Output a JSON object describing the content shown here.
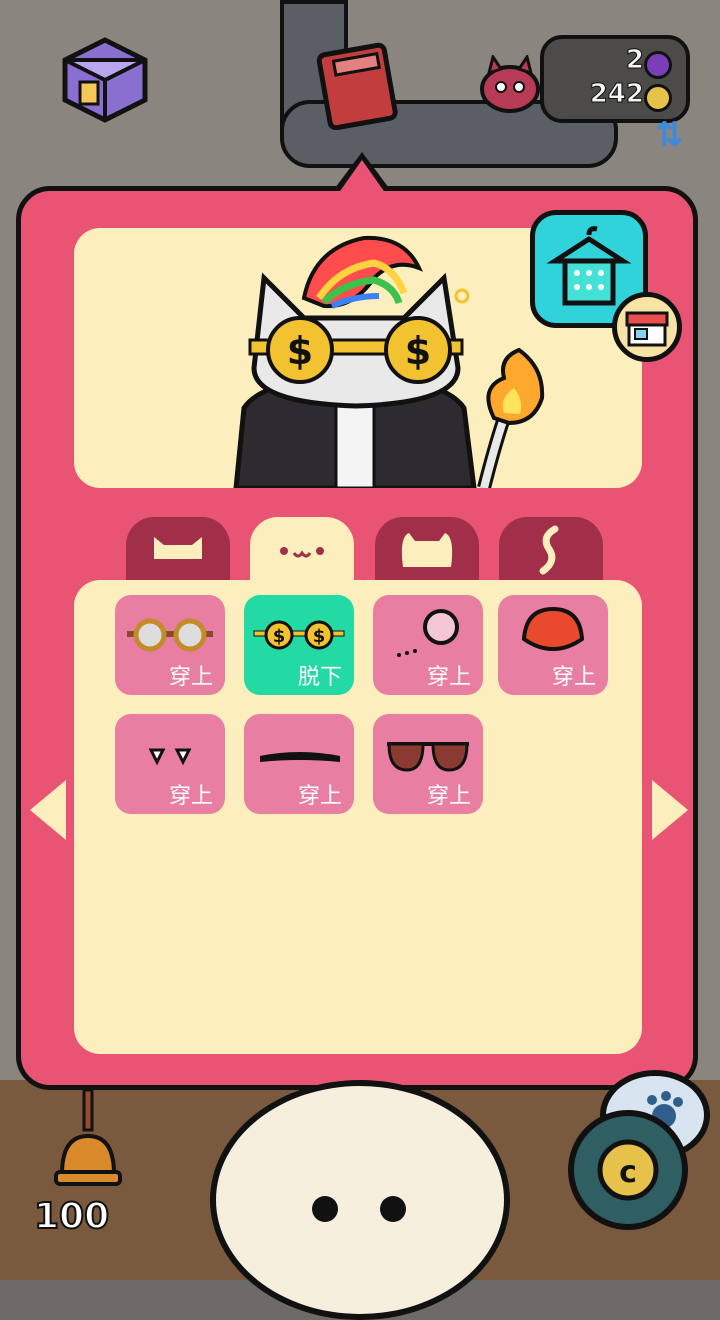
{
  "hud": {
    "gems": "2",
    "coins": "242",
    "money": "100"
  },
  "tabs": [
    {
      "id": "head",
      "icon": "cat-ears-icon",
      "active": false
    },
    {
      "id": "face",
      "icon": "cat-face-icon",
      "active": true
    },
    {
      "id": "body",
      "icon": "cat-body-icon",
      "active": false
    },
    {
      "id": "tail",
      "icon": "tail-icon",
      "active": false
    }
  ],
  "items": [
    {
      "icon": "steampunk-goggles-icon",
      "label": "穿上",
      "equipped": false
    },
    {
      "icon": "dollar-glasses-icon",
      "label": "脱下",
      "equipped": true
    },
    {
      "icon": "monocle-icon",
      "label": "穿上",
      "equipped": false
    },
    {
      "icon": "red-mask-icon",
      "label": "穿上",
      "equipped": false
    },
    {
      "icon": "fangs-icon",
      "label": "穿上",
      "equipped": false
    },
    {
      "icon": "mustache-icon",
      "label": "穿上",
      "equipped": false
    },
    {
      "icon": "aviator-sunglasses-icon",
      "label": "穿上",
      "equipped": false
    }
  ],
  "colors": {
    "panel": "#e95475",
    "cream": "#fdeebd",
    "item": "#e87fa2",
    "equipped": "#23d9a4",
    "tab_inactive": "#a12f4a",
    "wardrobe": "#2fd3d9"
  }
}
